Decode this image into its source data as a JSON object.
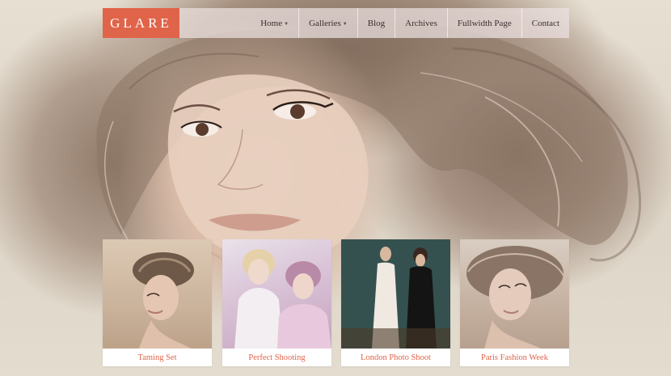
{
  "brand": {
    "logo_text": "GLARE"
  },
  "nav": {
    "items": [
      {
        "label": "Home",
        "has_submenu": true
      },
      {
        "label": "Galleries",
        "has_submenu": true
      },
      {
        "label": "Blog",
        "has_submenu": false
      },
      {
        "label": "Archives",
        "has_submenu": false
      },
      {
        "label": "Fullwidth Page",
        "has_submenu": false
      },
      {
        "label": "Contact",
        "has_submenu": false
      }
    ],
    "submenu_glyph": "▼"
  },
  "galleries": [
    {
      "caption": "Taming Set"
    },
    {
      "caption": "Perfect Shooting"
    },
    {
      "caption": "London Photo Shoot"
    },
    {
      "caption": "Paris Fashion Week"
    }
  ],
  "colors": {
    "accent": "#e0644a",
    "nav_bg": "#ebe1e1",
    "nav_text": "#3a3030",
    "card_bg": "#ffffff"
  }
}
